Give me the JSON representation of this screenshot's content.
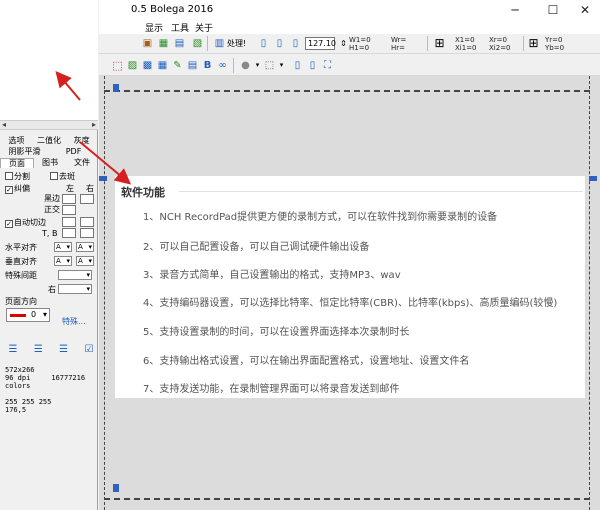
{
  "left_panel": {
    "tabs_row1": [
      "选项",
      "二值化",
      "灰度"
    ],
    "tabs_row2": [
      "阴影平滑",
      "PDF"
    ],
    "tabs_row3": [
      "页面",
      "图书",
      "文件"
    ],
    "opt_split": "分割",
    "opt_bleed": "去斑",
    "opt_deskew": "纠偏",
    "col_left": "左",
    "col_right": "右",
    "opt_black": "黑边",
    "opt_correct": "正交",
    "opt_autocut": "自动切边",
    "tb_label": "T, B",
    "h_align": "水平对齐",
    "v_align": "垂直对齐",
    "special_spacing": "特殊间距",
    "right_label": "右",
    "page_direction": "页面方向",
    "align_value": "A",
    "color_value": "0",
    "special_link": "特殊...",
    "info_lines": [
      "572x266",
      "96 dpi     16777216",
      "colors",
      "",
      "255 255 255",
      "176,5"
    ]
  },
  "window": {
    "title": "0.5  Bolega 2016",
    "menu": [
      "显示",
      "工具",
      "关于"
    ],
    "zoom": "127.10",
    "process_label": "处理!",
    "coords": {
      "w1": "W1=0",
      "h1": "H1=0",
      "wr": "Wr=",
      "hr": "Hr=",
      "x1": "X1=0",
      "x11": "Xi1=0",
      "xr": "Xr=0",
      "x12": "Xi2=0",
      "yr": "Yr=0",
      "yb": "Yb=0"
    }
  },
  "document": {
    "heading": "软件功能",
    "items": [
      "1、NCH RecordPad提供更方便的录制方式，可以在软件找到你需要录制的设备",
      "2、可以自己配置设备，可以自己调试硬件输出设备",
      "3、录音方式简单，自己设置输出的格式，支持MP3、wav",
      "4、支持编码器设置，可以选择比特率、恒定比特率(CBR)、比特率(kbps)、高质量编码(较慢)",
      "5、支持设置录制的时间，可以在设置界面选择本次录制时长",
      "6、支持输出格式设置，可以在输出界面配置格式，设置地址、设置文件名",
      "7、支持发送功能，在录制管理界面可以将录音发送到邮件"
    ]
  },
  "colors": {
    "arrow_red": "#d42020",
    "accent_blue": "#2060c0"
  }
}
